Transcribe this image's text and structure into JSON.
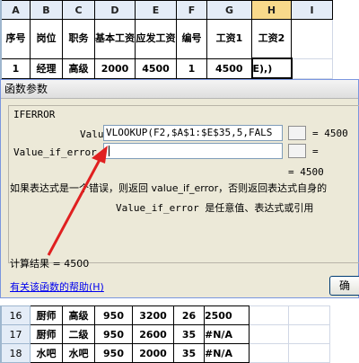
{
  "columns": [
    "A",
    "B",
    "C",
    "D",
    "E",
    "F",
    "G",
    "H",
    "I"
  ],
  "header_cells": [
    "序号",
    "岗位",
    "职务",
    "基本工资",
    "应发工资",
    "编号",
    "工资1",
    "工资2"
  ],
  "data_row_1": {
    "rownum": "",
    "a": "1",
    "b": "经理",
    "c": "高级",
    "d": "2000",
    "e": "4500",
    "f": "1",
    "g": "4500",
    "h": "E),)"
  },
  "bottom_rows": [
    {
      "rownum": "16",
      "a": "16",
      "b": "厨师",
      "c": "高级",
      "d": "950",
      "e": "3200",
      "f": "26",
      "g": "2500"
    },
    {
      "rownum": "17",
      "a": "17",
      "b": "厨师",
      "c": "二级",
      "d": "950",
      "e": "2600",
      "f": "35",
      "g": "#N/A"
    },
    {
      "rownum": "18",
      "a": "18",
      "b": "水吧",
      "c": "水吧",
      "d": "950",
      "e": "2000",
      "f": "35",
      "g": "#N/A"
    }
  ],
  "dialog": {
    "title": "函数参数",
    "function_name": "IFERROR",
    "args": [
      {
        "label": "Value",
        "value": "VLOOKUP(F2,$A$1:$E$35,5,FALS",
        "result": "= 4500"
      },
      {
        "label": "Value_if_error",
        "value": "",
        "result": "="
      }
    ],
    "overall_result_line": "= 4500",
    "description": "如果表达式是一个错误，则返回 value_if_error，否则返回表达式自身的",
    "arg_description": "Value_if_error  是任意值、表达式或引用",
    "calc_result": "计算结果 =  4500",
    "help_link": "有关该函数的帮助(H)",
    "ok_button": "确"
  }
}
